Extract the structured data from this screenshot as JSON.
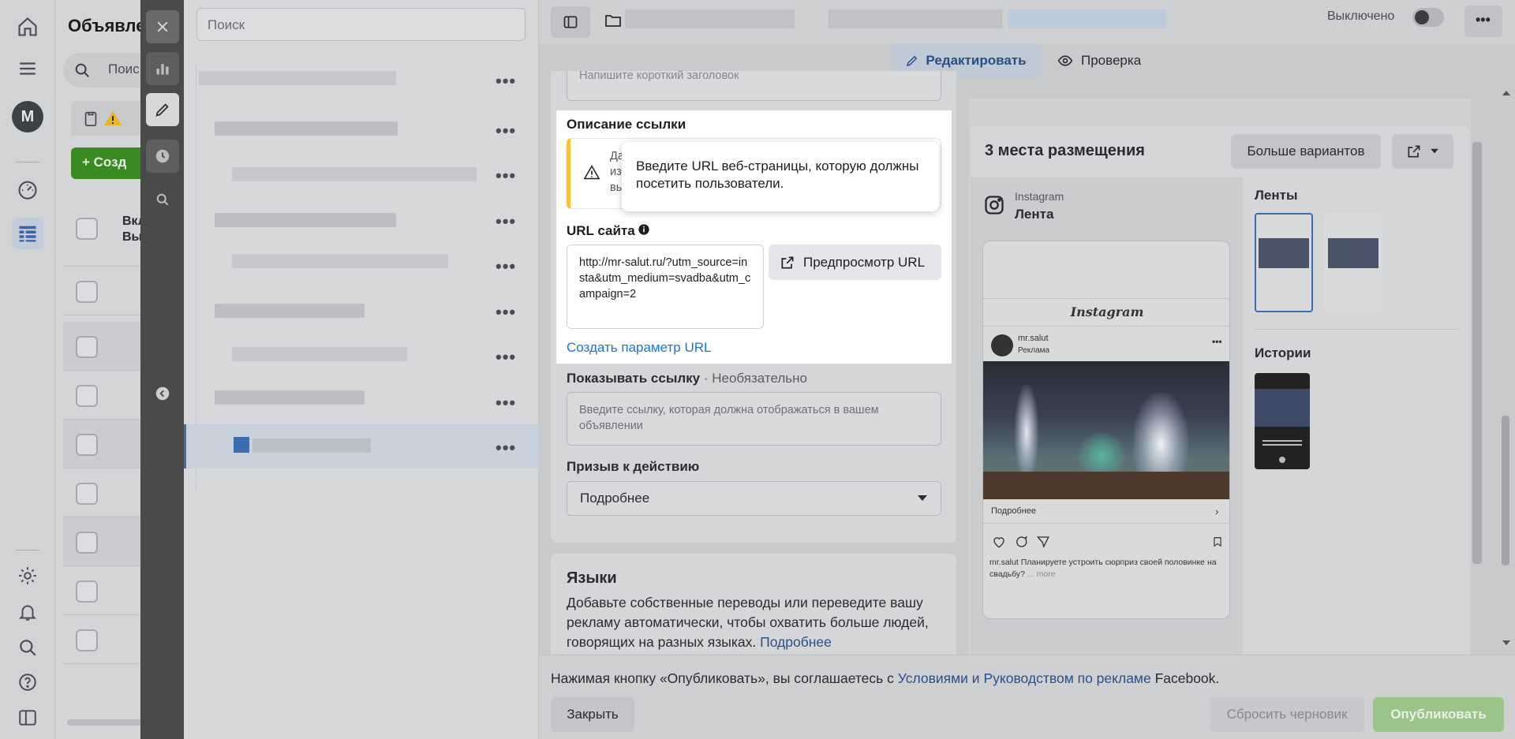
{
  "nav": {
    "avatar_letter": "M"
  },
  "campaigns": {
    "title": "Объявле",
    "search_placeholder": "Поис",
    "create_label": "+ Созд",
    "col_header_1": "Вкл",
    "col_header_2": "Вы"
  },
  "tree": {
    "search_placeholder": "Поиск",
    "more_label": "•••"
  },
  "topbar": {
    "status_label": "Выключено",
    "more_label": "•••",
    "edit_label": "Редактировать",
    "review_label": "Проверка"
  },
  "form": {
    "headline_placeholder": "Напишите короткий заголовок",
    "link_description_label": "Описание ссылки",
    "warning_line_1": "Да",
    "warning_line_2": "из",
    "warning_line_3": "вы",
    "tooltip_text": "Введите URL веб-страницы, которую должны посетить пользователи.",
    "website_url_label": "URL сайта",
    "website_url_value": "http://mr-salut.ru/?utm_source=insta&utm_medium=svadba&utm_campaign=2",
    "preview_url_label": "Предпросмотр URL",
    "create_param_label": "Создать параметр URL",
    "display_link_label": "Показывать ссылку",
    "display_link_optional": "· Необязательно",
    "display_link_placeholder": "Введите ссылку, которая должна отображаться в вашем объявлении",
    "cta_label": "Призыв к действию",
    "cta_value": "Подробнее",
    "languages_title": "Языки",
    "languages_text": "Добавьте собственные переводы или переведите вашу рекламу автоматически, чтобы охватить больше людей, говорящих на разных языках.",
    "languages_link": "Подробнее"
  },
  "preview": {
    "placements_title": "3 места размещения",
    "more_options_label": "Больше вариантов",
    "platform_label": "Instagram",
    "placement_label": "Лента",
    "feeds_label": "Ленты",
    "stories_label": "Истории",
    "ig_logo_text": "Instagram",
    "post_username": "mr.salut",
    "post_sponsored": "Реклама",
    "post_cta": "Подробнее",
    "post_caption_user": "mr.salut",
    "post_caption": "Планируете устроить сюрприз своей половинке на свадьбу?",
    "post_more": "... more"
  },
  "footer": {
    "terms_prefix": "Нажимая кнопку «Опубликовать», вы соглашаетесь с ",
    "terms_link": "Условиями и Руководством по рекламе",
    "terms_suffix": " Facebook.",
    "close_label": "Закрыть",
    "reset_label": "Сбросить черновик",
    "publish_label": "Опубликовать"
  },
  "colors": {
    "accent": "#1b74e4",
    "publish": "#42b72a",
    "warning": "#f5c33b"
  }
}
